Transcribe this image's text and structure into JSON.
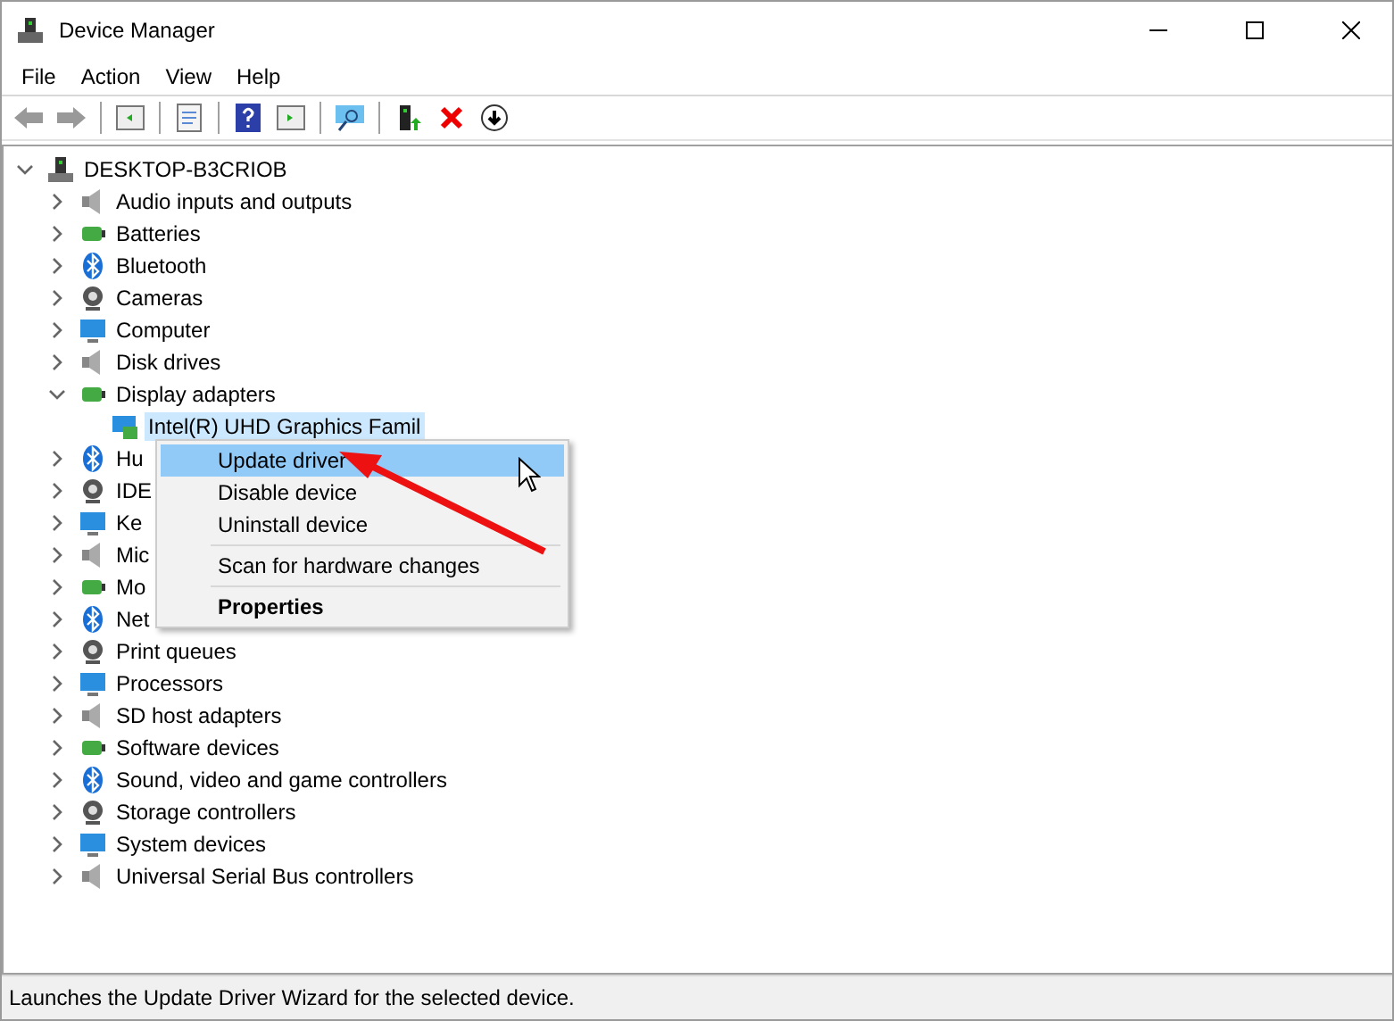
{
  "window": {
    "title": "Device Manager"
  },
  "menu": [
    "File",
    "Action",
    "View",
    "Help"
  ],
  "tree": {
    "label": "DESKTOP-B3CRIOB",
    "expanded": true,
    "children": [
      {
        "label": "Audio inputs and outputs",
        "expanded": false
      },
      {
        "label": "Batteries",
        "expanded": false
      },
      {
        "label": "Bluetooth",
        "expanded": false
      },
      {
        "label": "Cameras",
        "expanded": false
      },
      {
        "label": "Computer",
        "expanded": false
      },
      {
        "label": "Disk drives",
        "expanded": false
      },
      {
        "label": "Display adapters",
        "expanded": true,
        "children": [
          {
            "label": "Intel(R) UHD Graphics Famil",
            "selected": true
          }
        ]
      },
      {
        "label": "Hu",
        "expanded": false
      },
      {
        "label": "IDE",
        "expanded": false
      },
      {
        "label": "Ke",
        "expanded": false
      },
      {
        "label": "Mic",
        "expanded": false
      },
      {
        "label": "Mo",
        "expanded": false
      },
      {
        "label": "Net",
        "expanded": false
      },
      {
        "label": "Print queues",
        "expanded": false
      },
      {
        "label": "Processors",
        "expanded": false
      },
      {
        "label": "SD host adapters",
        "expanded": false
      },
      {
        "label": "Software devices",
        "expanded": false
      },
      {
        "label": "Sound, video and game controllers",
        "expanded": false
      },
      {
        "label": "Storage controllers",
        "expanded": false
      },
      {
        "label": "System devices",
        "expanded": false
      },
      {
        "label": "Universal Serial Bus controllers",
        "expanded": false
      }
    ]
  },
  "context_menu": {
    "items": [
      {
        "kind": "item",
        "label": "Update driver",
        "selected": true,
        "default": false
      },
      {
        "kind": "item",
        "label": "Disable device",
        "selected": false,
        "default": false
      },
      {
        "kind": "item",
        "label": "Uninstall device",
        "selected": false,
        "default": false
      },
      {
        "kind": "separator"
      },
      {
        "kind": "item",
        "label": "Scan for hardware changes",
        "selected": false,
        "default": false
      },
      {
        "kind": "separator"
      },
      {
        "kind": "item",
        "label": "Properties",
        "selected": false,
        "default": true
      }
    ]
  },
  "status_bar": "Launches the Update Driver Wizard for the selected device."
}
